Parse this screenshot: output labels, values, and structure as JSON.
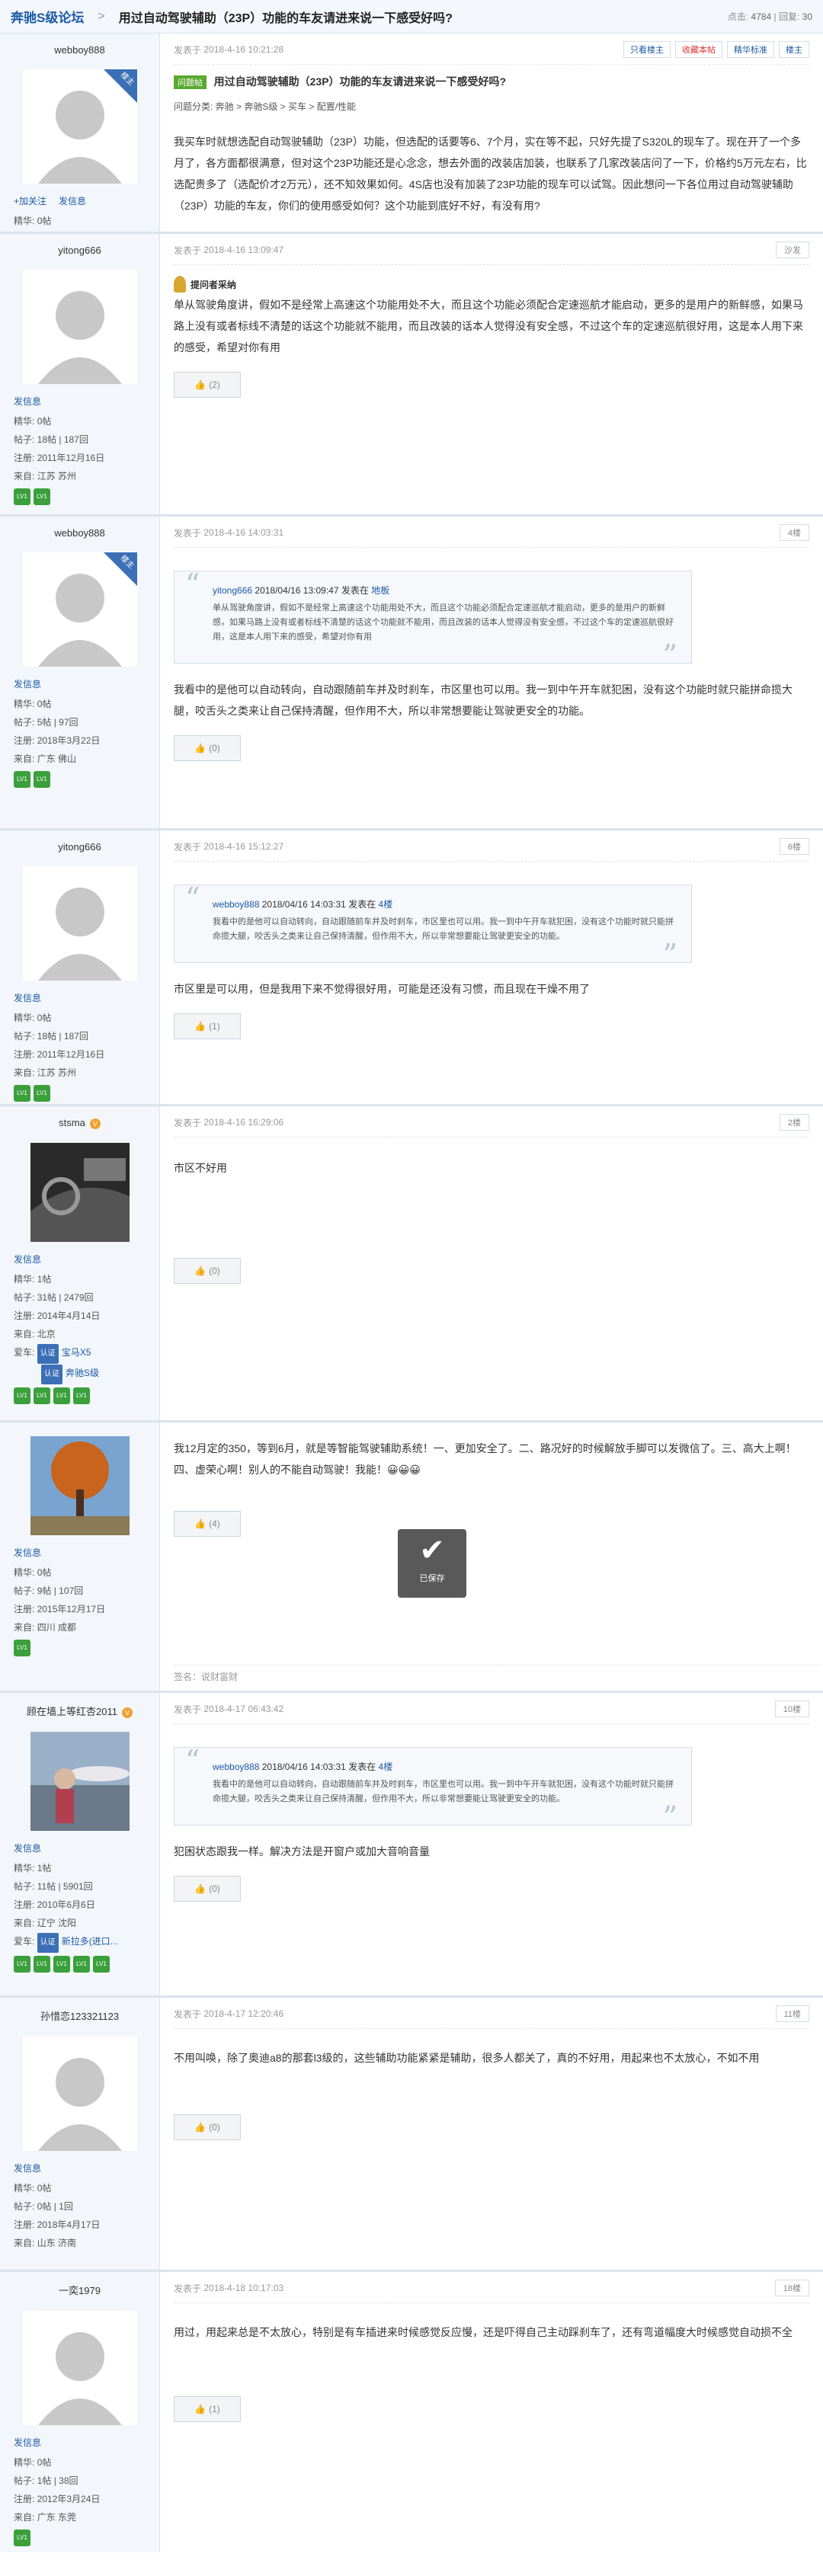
{
  "header": {
    "forum": "奔驰S级论坛",
    "sep": ">",
    "title": "用过自动驾驶辅助（23P）功能的车友请进来说一下感受好吗?",
    "views_label": "点击:",
    "views": "4784",
    "replies_label": "回复:",
    "replies": "30"
  },
  "labels": {
    "posted_at": "发表于",
    "send_msg": "发信息",
    "add_friend": "加关注",
    "jinghua": "精华:",
    "tiezi": "帖子:",
    "zhuce": "注册:",
    "laizi": "来自:",
    "aiche": "爱车:",
    "cert": "认证",
    "owner_badge": "楼主",
    "quote_posted": "发表在"
  },
  "post1": {
    "user": "webboy888",
    "jinghua": "0帖",
    "time": "2018-4-16 10:21:28",
    "tools": [
      "只看楼主",
      "收藏本帖",
      "精华标准",
      "楼主"
    ],
    "qtag": "问题帖",
    "qtitle": "用过自动驾驶辅助（23P）功能的车友请进来说一下感受好吗?",
    "category": "问题分类: 奔驰 > 奔驰S级 > 买车 > 配置/性能",
    "body": "我买车时就想选配自动驾驶辅助（23P）功能，但选配的话要等6、7个月，实在等不起，只好先提了S320L的现车了。现在开了一个多月了，各方面都很满意，但对这个23P功能还是心念念，想去外面的改装店加装，也联系了几家改装店问了一下，价格约5万元左右，比选配贵多了（选配价才2万元），还不知效果如何。4S店也没有加装了23P功能的现车可以试驾。因此想问一下各位用过自动驾驶辅助（23P）功能的车友，你们的使用感受如何？这个功能到底好不好，有没有用?"
  },
  "post2": {
    "user": "yitong666",
    "jinghua": "0帖",
    "tiezi": "18帖 | 187回",
    "zhuce": "2011年12月16日",
    "laizi": "江苏 苏州",
    "time": "2018-4-16 13:09:47",
    "floor": "沙发",
    "best": "提问者采纳",
    "body": "单从驾驶角度讲，假如不是经常上高速这个功能用处不大，而且这个功能必须配合定速巡航才能启动，更多的是用户的新鲜感，如果马路上没有或者标线不清楚的话这个功能就不能用，而且改装的话本人觉得没有安全感，不过这个车的定速巡航很好用，这是本人用下来的感受，希望对你有用",
    "likes": "(2)"
  },
  "post3": {
    "user": "webboy888",
    "jinghua": "0帖",
    "tiezi": "5帖 | 97回",
    "zhuce": "2018年3月22日",
    "laizi": "广东 佛山",
    "time": "2018-4-16 14:03:31",
    "floor": "4楼",
    "quote_user": "yitong666",
    "quote_time": "2018/04/16 13:09:47",
    "quote_loc": "地板",
    "quote_body": "单从驾驶角度讲，假如不是经常上高速这个功能用处不大，而且这个功能必须配合定速巡航才能启动，更多的是用户的新鲜感，如果马路上没有或者标线不清楚的话这个功能就不能用，而且改装的话本人觉得没有安全感，不过这个车的定速巡航很好用，这是本人用下来的感受，希望对你有用",
    "body": "我看中的是他可以自动转向，自动跟随前车并及时刹车，市区里也可以用。我一到中午开车就犯困，没有这个功能时就只能拼命揽大腿，咬舌头之类来让自己保持清醒，但作用不大，所以非常想要能让驾驶更安全的功能。",
    "likes": "(0)"
  },
  "post4": {
    "user": "yitong666",
    "jinghua": "0帖",
    "tiezi": "18帖 | 187回",
    "zhuce": "2011年12月16日",
    "laizi": "江苏 苏州",
    "time": "2018-4-16 15:12:27",
    "floor": "6楼",
    "quote_user": "webboy888",
    "quote_time": "2018/04/16 14:03:31",
    "quote_loc": "4楼",
    "quote_body": "我看中的是他可以自动转向，自动跟随前车并及时刹车，市区里也可以用。我一到中午开车就犯困，没有这个功能时就只能拼命揽大腿，咬舌头之类来让自己保持清醒，但作用不大，所以非常想要能让驾驶更安全的功能。",
    "body": "市区里是可以用，但是我用下来不觉得很好用，可能是还没有习惯，而且现在干燥不用了",
    "likes": "(1)"
  },
  "post5": {
    "user": "stsma",
    "jinghua": "1帖",
    "tiezi": "31帖 | 2479回",
    "zhuce": "2014年4月14日",
    "laizi": "北京",
    "car1": "宝马X5",
    "car2": "奔驰S级",
    "time": "2018-4-16 16:29:06",
    "floor": "2楼",
    "body": "市区不好用",
    "likes": "(0)"
  },
  "post6": {
    "jinghua": "0帖",
    "tiezi": "9帖 | 107回",
    "zhuce": "2015年12月17日",
    "laizi": "四川 成都",
    "body": "我12月定的350，等到6月，就是等智能驾驶辅助系统！一、更加安全了。二、路况好的时候解放手脚可以发微信了。三、高大上啊！四、虚荣心啊！别人的不能自动驾驶！我能！😀😀😀",
    "likes": "(4)",
    "saved": "已保存",
    "sig": "签名：说财富财"
  },
  "post7": {
    "user": "顾在墙上等红杏2011",
    "jinghua": "1帖",
    "tiezi": "11帖 | 5901回",
    "zhuce": "2010年6月6日",
    "laizi": "辽宁 沈阳",
    "car1": "新拉多(进口...",
    "time": "2018-4-17 06:43:42",
    "floor": "10楼",
    "quote_user": "webboy888",
    "quote_time": "2018/04/16 14:03:31",
    "quote_loc": "4楼",
    "quote_body": "我看中的是他可以自动转向，自动跟随前车并及时刹车，市区里也可以用。我一到中午开车就犯困，没有这个功能时就只能拼命揽大腿，咬舌头之类来让自己保持清醒，但作用不大，所以非常想要能让驾驶更安全的功能。",
    "body": "犯困状态跟我一样。解决方法是开窗户或加大音响音量",
    "likes": "(0)"
  },
  "post8": {
    "user": "孙惜恋123321123",
    "jinghua": "0帖",
    "tiezi": "0帖 | 1回",
    "zhuce": "2018年4月17日",
    "laizi": "山东 济南",
    "time": "2018-4-17 12:20:46",
    "floor": "11楼",
    "body": "不用叫唤，除了奥迪a8的那套l3级的，这些辅助功能紧紧是辅助，很多人都关了，真的不好用，用起来也不太放心，不如不用",
    "likes": "(0)"
  },
  "post9": {
    "user": "一奕1979",
    "jinghua": "0帖",
    "tiezi": "1帖 | 38回",
    "zhuce": "2012年3月24日",
    "laizi": "广东 东莞",
    "time": "2018-4-18 10:17:03",
    "floor": "18楼",
    "body": "用过，用起来总是不太放心，特别是有车插进来时候感觉反应慢，还是吓得自己主动踩刹车了，还有弯道幅度大时候感觉自动损不全",
    "likes": "(1)"
  }
}
